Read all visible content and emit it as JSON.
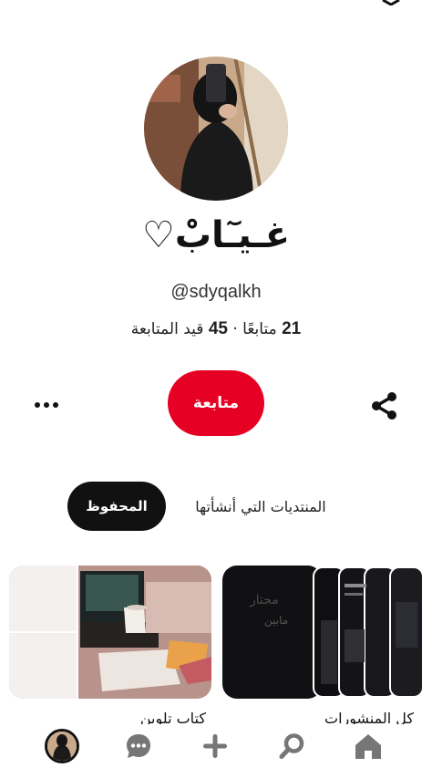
{
  "profile": {
    "display_name": "غـيـٓابْ♡",
    "username": "@sdyqalkh",
    "followers_count": "21",
    "followers_label": "متابعًا",
    "separator": "·",
    "following_count": "45",
    "following_label": "قيد المتابعة"
  },
  "actions": {
    "follow_label": "متابعة",
    "more_icon": "more-horizontal-icon",
    "share_icon": "share-icon"
  },
  "tabs": {
    "created_label": "المنتديات التي أنشأتها",
    "saved_label": "المحفوظ",
    "active": "saved"
  },
  "boards": [
    {
      "title": "كتاب تلوين",
      "cover": "desk-with-laptop-and-cup"
    },
    {
      "title": "كل المنشورات",
      "cover": "dark-phone-screenshots"
    }
  ],
  "bottom_nav": {
    "items": [
      "profile-avatar",
      "messages-icon",
      "create-icon",
      "search-icon",
      "home-icon"
    ]
  },
  "colors": {
    "accent": "#e60023",
    "tab_active_bg": "#111111",
    "nav_icon": "#767676"
  }
}
